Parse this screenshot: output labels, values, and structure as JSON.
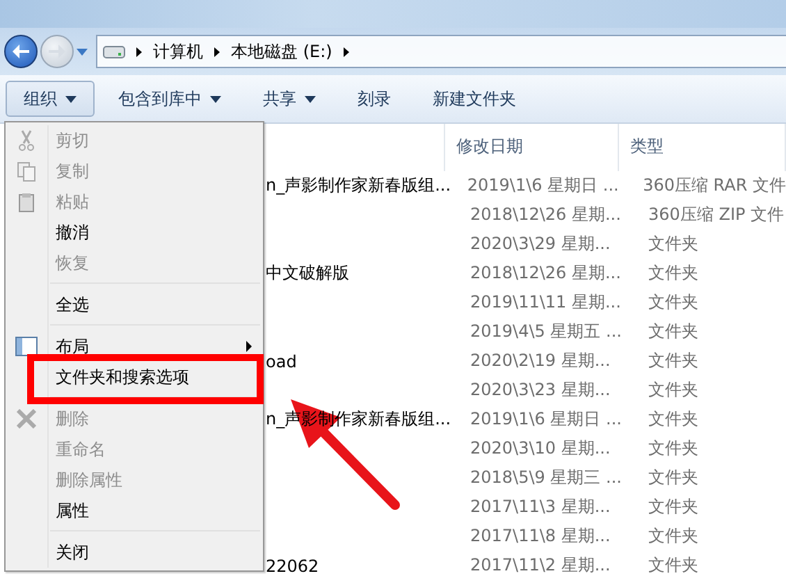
{
  "address": {
    "crumbs": [
      "计算机",
      "本地磁盘 (E:)"
    ]
  },
  "toolbar": [
    {
      "label": "组织",
      "dropdown": true,
      "selected": true
    },
    {
      "label": "包含到库中",
      "dropdown": true,
      "selected": false
    },
    {
      "label": "共享",
      "dropdown": true,
      "selected": false
    },
    {
      "label": "刻录",
      "dropdown": false,
      "selected": false
    },
    {
      "label": "新建文件夹",
      "dropdown": false,
      "selected": false
    }
  ],
  "columns": [
    "修改日期",
    "类型"
  ],
  "rows": [
    {
      "name": "n_声影制作家新春版组...",
      "date": "2019\\1\\6 星期日 ...",
      "type": "360压缩 RAR 文件"
    },
    {
      "name": "",
      "date": "2018\\12\\26 星期...",
      "type": "360压缩 ZIP 文件"
    },
    {
      "name": "",
      "date": "2020\\3\\29 星期...",
      "type": "文件夹"
    },
    {
      "name": "中文破解版",
      "date": "2018\\12\\26 星期...",
      "type": "文件夹"
    },
    {
      "name": "",
      "date": "2019\\11\\11 星期...",
      "type": "文件夹"
    },
    {
      "name": "",
      "date": "2019\\4\\5 星期五 ...",
      "type": "文件夹"
    },
    {
      "name": "oad",
      "date": "2020\\2\\19 星期...",
      "type": "文件夹"
    },
    {
      "name": "",
      "date": "2020\\3\\23 星期...",
      "type": "文件夹"
    },
    {
      "name": "n_声影制作家新春版组...",
      "date": "2019\\1\\6 星期日 ...",
      "type": "文件夹"
    },
    {
      "name": "",
      "date": "2020\\3\\10 星期...",
      "type": "文件夹"
    },
    {
      "name": "",
      "date": "2018\\5\\9 星期三 ...",
      "type": "文件夹"
    },
    {
      "name": "",
      "date": "2017\\11\\3 星期...",
      "type": "文件夹"
    },
    {
      "name": "",
      "date": "2017\\11\\8 星期...",
      "type": "文件夹"
    },
    {
      "name": "22062",
      "date": "2017\\11\\2 星期...",
      "type": "文件夹"
    }
  ],
  "menu": {
    "items": [
      {
        "kind": "item",
        "label": "剪切",
        "disabled": true,
        "submenu": false
      },
      {
        "kind": "item",
        "label": "复制",
        "disabled": true,
        "submenu": false
      },
      {
        "kind": "item",
        "label": "粘贴",
        "disabled": true,
        "submenu": false
      },
      {
        "kind": "item",
        "label": "撤消",
        "disabled": false,
        "submenu": false
      },
      {
        "kind": "item",
        "label": "恢复",
        "disabled": true,
        "submenu": false
      },
      {
        "kind": "separator"
      },
      {
        "kind": "item",
        "label": "全选",
        "disabled": false,
        "submenu": false
      },
      {
        "kind": "separator"
      },
      {
        "kind": "item",
        "label": "布局",
        "disabled": false,
        "submenu": true
      },
      {
        "kind": "item",
        "label": "文件夹和搜索选项",
        "disabled": false,
        "submenu": false
      },
      {
        "kind": "separator"
      },
      {
        "kind": "item",
        "label": "删除",
        "disabled": true,
        "submenu": false
      },
      {
        "kind": "item",
        "label": "重命名",
        "disabled": true,
        "submenu": false
      },
      {
        "kind": "item",
        "label": "删除属性",
        "disabled": true,
        "submenu": false
      },
      {
        "kind": "item",
        "label": "属性",
        "disabled": false,
        "submenu": false
      },
      {
        "kind": "separator"
      },
      {
        "kind": "item",
        "label": "关闭",
        "disabled": false,
        "submenu": false
      }
    ]
  }
}
